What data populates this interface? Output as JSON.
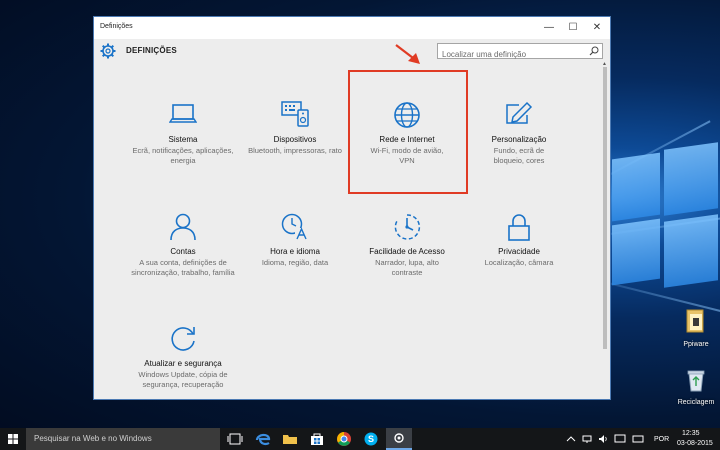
{
  "window": {
    "title": "Definições",
    "minimize": "—",
    "maximize": "☐",
    "close": "✕"
  },
  "header": {
    "title": "DEFINIÇÕES",
    "search_placeholder": "Localizar uma definição"
  },
  "tiles": [
    {
      "title": "Sistema",
      "desc": "Ecrã, notificações, aplicações, energia",
      "icon": "laptop-icon"
    },
    {
      "title": "Dispositivos",
      "desc": "Bluetooth, impressoras, rato",
      "icon": "devices-icon"
    },
    {
      "title": "Rede e Internet",
      "desc": "Wi-Fi, modo de avião, VPN",
      "icon": "globe-icon"
    },
    {
      "title": "Personalização",
      "desc": "Fundo, ecrã de bloqueio, cores",
      "icon": "personalization-icon"
    },
    {
      "title": "Contas",
      "desc": "A sua conta, definições de sincronização, trabalho, família",
      "icon": "person-icon"
    },
    {
      "title": "Hora e idioma",
      "desc": "Idioma, região, data",
      "icon": "time-language-icon"
    },
    {
      "title": "Facilidade de Acesso",
      "desc": "Narrador, lupa, alto contraste",
      "icon": "accessibility-icon"
    },
    {
      "title": "Privacidade",
      "desc": "Localização, câmara",
      "icon": "lock-icon"
    },
    {
      "title": "Atualizar e segurança",
      "desc": "Windows Update, cópia de segurança, recuperação",
      "icon": "update-icon"
    }
  ],
  "desktop": {
    "icons": [
      {
        "label": "Ppiware",
        "icon": "folder-icon"
      },
      {
        "label": "Reciclagem",
        "icon": "recycle-bin-icon"
      }
    ]
  },
  "taskbar": {
    "search_text": "Pesquisar na Web e no Windows",
    "language": "POR",
    "time": "12:35",
    "date": "03-08-2015"
  },
  "colors": {
    "accent": "#1a73c8",
    "highlight": "#e03b24"
  }
}
